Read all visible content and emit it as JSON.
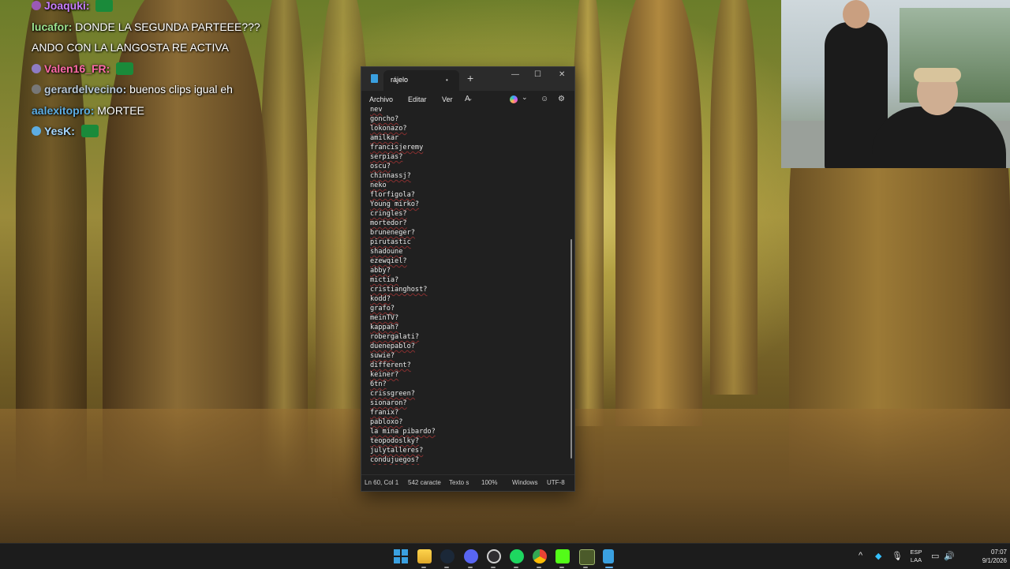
{
  "chat": {
    "lines": [
      {
        "user": "Joaquki",
        "message": "",
        "user_color": "#c77dff",
        "badge_color": "#9b59b6",
        "emote": "green-bag-emote"
      },
      {
        "user": "lucafor",
        "message": "DONDE LA SEGUNDA PARTEEE???",
        "user_color": "#9be28f",
        "badge_color": "",
        "emote": ""
      },
      {
        "user": "",
        "message": "ANDO CON LA LANGOSTA RE ACTIVA",
        "user_color": "#ffffff",
        "badge_color": "",
        "emote": ""
      },
      {
        "user": "Valen16_FR",
        "message": "",
        "user_color": "#ff6aa8",
        "badge_color": "#8e7cc3",
        "emote": "green-bag-emote"
      },
      {
        "user": "gerardelvecino",
        "message": "buenos clips igual eh",
        "user_color": "#b7c7d6",
        "badge_color": "#777777",
        "emote": ""
      },
      {
        "user": "aalexitopro",
        "message": "MORTEE",
        "user_color": "#5dade2",
        "badge_color": "",
        "emote": ""
      },
      {
        "user": "YesK",
        "message": "",
        "user_color": "#a7d8ff",
        "badge_color": "#5dade2",
        "emote": "green-bag-emote"
      }
    ]
  },
  "notepad": {
    "tab_title": "rájelo",
    "unsaved_dot": "•",
    "new_tab": "+",
    "window_buttons": {
      "minimize": "—",
      "maximize": "☐",
      "close": "✕"
    },
    "menu": {
      "file": "Archivo",
      "edit": "Editar",
      "view": "Ver"
    },
    "lines": [
      "nev",
      "goncho?",
      "lokonazo?",
      "amilkar",
      "francisjeremy",
      "serpias?",
      "oscu?",
      "chinnassj?",
      "neko",
      "florfigola?",
      "Young mirko?",
      "cringles?",
      "mortedor?",
      "bruneneger?",
      "pirutastic",
      "shadoune",
      "ezewqiel?",
      "abby?",
      "mictia?",
      "cristianghost?",
      "kodd?",
      "grafo?",
      "meinTV?",
      "kappah?",
      "robergalati?",
      "duenepablo?",
      "suwie?",
      "different?",
      "keiner?",
      "6tn?",
      "crissgreen?",
      "sionaron?",
      "franix?",
      "pabloxo?",
      "la mina pibardo?",
      "teopodoslky?",
      "julytalleres?",
      "condujuegos?"
    ],
    "status": {
      "position": "Ln 60, Col 1",
      "characters": "542 caracte",
      "format": "Texto s",
      "zoom": "100%",
      "line_ending": "Windows",
      "encoding": "UTF-8"
    }
  },
  "taskbar": {
    "apps": [
      "windows-start-icon",
      "file-explorer-icon",
      "steam-icon",
      "discord-icon",
      "obs-icon",
      "spotify-icon",
      "chrome-icon",
      "kick-icon",
      "terminal-icon",
      "notepad-icon"
    ],
    "tray": {
      "lang_line1": "ESP",
      "lang_line2": "LAA",
      "time": "07:07",
      "date": "9/1/2026"
    }
  },
  "colors": {
    "notepad_bg": "#202020",
    "taskbar_bg": "#1c1c1c",
    "accent": "#3aa0e0",
    "spellcheck": "#dc3c3c"
  }
}
